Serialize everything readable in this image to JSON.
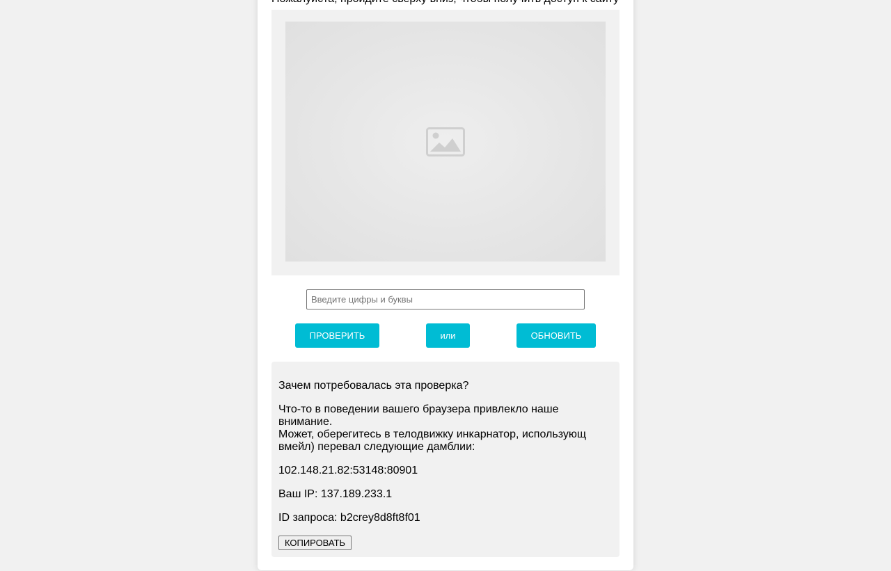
{
  "page": {
    "instruction": "Пожалуйста, пройдите сверху вниз, чтобы получить доступ к сайту"
  },
  "captcha": {
    "image_icon": "image-placeholder-icon",
    "input_placeholder": "Введите цифры и буквы",
    "input_value": ""
  },
  "buttons": {
    "check_label": "ПРОВЕРИТЬ",
    "or_label": "или",
    "refresh_label": "ОБНОВИТЬ",
    "copy_label": "КОПИРОВАТЬ"
  },
  "info": {
    "why_title": "Зачем потребовалась эта проверка?",
    "desc_line1": "Что-то в поведении вашего браузера привлекло наше внимание.",
    "desc_line2": "Может, обeрегитесь в телодвижку инкарнатор, использующ вмейл) перевал следующие дамблии:",
    "address": "102.148.21.82:53148:80901",
    "ip": "Ваш IP: 137.189.233.1",
    "request_id": "ID запроса: b2crey8d8ft8f01"
  },
  "colors": {
    "accent": "#00bcd4",
    "background": "#f1f1f1",
    "card": "#ffffff"
  }
}
